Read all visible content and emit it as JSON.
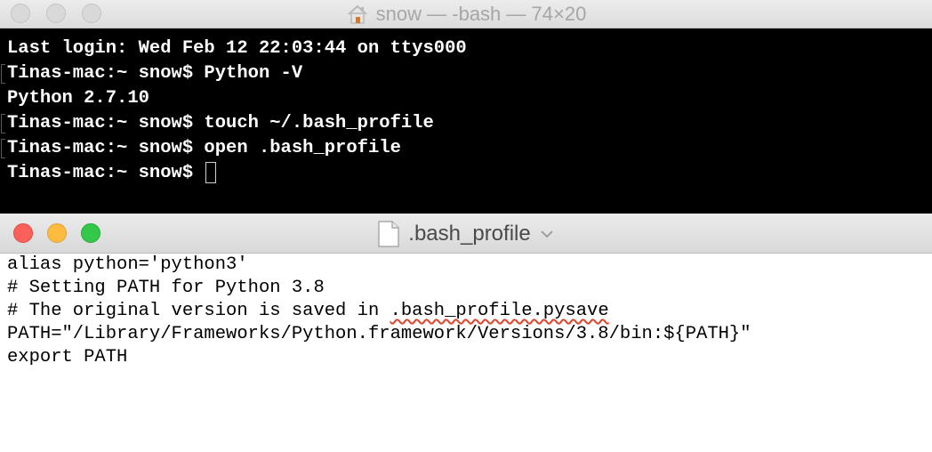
{
  "terminal_window": {
    "title": "snow — -bash — 74×20",
    "lines": [
      {
        "text": "Last login: Wed Feb 12 22:03:44 on ttys000"
      },
      {
        "text": "Tinas-mac:~ snow$ Python -V"
      },
      {
        "text": "Python 2.7.10"
      },
      {
        "text": "Tinas-mac:~ snow$ touch ~/.bash_profile"
      },
      {
        "text": "Tinas-mac:~ snow$ open .bash_profile"
      },
      {
        "text": "Tinas-mac:~ snow$ "
      }
    ]
  },
  "editor_window": {
    "title": ".bash_profile",
    "lines": [
      "alias python='python3'",
      "# Setting PATH for Python 3.8",
      "# The original version is saved in ",
      "PATH=\"/Library/Frameworks/Python.framework/Versions/3.8/bin:${PATH}\"",
      "export PATH"
    ],
    "misspelled_fragment": ".bash_profile.pysave"
  },
  "colors": {
    "terminal_bg": "#000000",
    "terminal_fg": "#ffffff",
    "close": "#fc605b",
    "minimize": "#fdbc40",
    "zoom": "#34c84a",
    "spellcheck": "#e0442a"
  },
  "icons": {
    "terminal_title": "home-icon",
    "editor_title": "document-icon",
    "editor_title_menu": "chevron-down-icon"
  }
}
